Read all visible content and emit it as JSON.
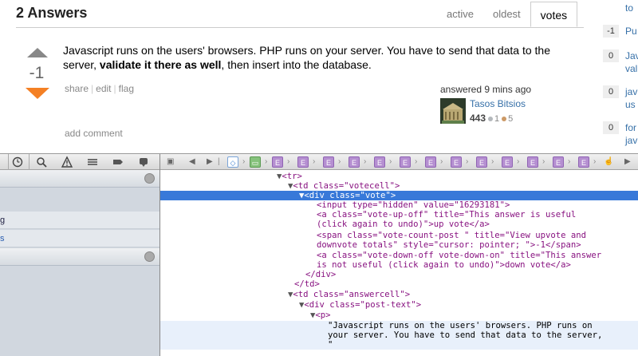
{
  "answers": {
    "title": "2 Answers",
    "tabs": [
      "active",
      "oldest",
      "votes"
    ],
    "selected_tab": "votes"
  },
  "answer": {
    "vote_count": "-1",
    "body_part1": "Javascript runs on the users' browsers. PHP runs on your server. You have to send that data to the server, ",
    "body_bold": "validate it there as well",
    "body_part2": ", then insert into the database.",
    "menu": [
      "share",
      "edit",
      "flag"
    ],
    "add_comment": "add comment",
    "action_time": "answered 9 mins ago",
    "user_name": "Tasos Bitsios",
    "reputation": "443",
    "silver_badges": "1",
    "bronze_badges": "5"
  },
  "sidebar": {
    "items": [
      {
        "score": "",
        "line1": "to",
        "line2": ""
      },
      {
        "score": "-1",
        "line1": "Pu",
        "line2": ""
      },
      {
        "score": "0",
        "line1": "Jav",
        "line2": "val"
      },
      {
        "score": "0",
        "line1": "jav",
        "line2": "us"
      },
      {
        "score": "0",
        "line1": "for",
        "line2": "jav"
      }
    ]
  },
  "left_panel": {
    "row2": "g",
    "row3": "s"
  },
  "dom": {
    "lines": [
      [
        "▼",
        "<tr>"
      ],
      [
        "▼",
        "<td class=\"votecell\">"
      ],
      [
        "▼",
        "<div class=\"vote\">"
      ],
      [
        "",
        "<input type=\"hidden\" value=\"16293181\">"
      ],
      [
        "",
        "<a class=\"vote-up-off\" title=\"This answer is useful"
      ],
      [
        "",
        "(click again to undo)\">up vote</a>"
      ],
      [
        "",
        "<span class=\"vote-count-post \" title=\"View upvote and"
      ],
      [
        "",
        "downvote totals\" style=\"cursor: pointer; \">-1</span>"
      ],
      [
        "",
        "<a class=\"vote-down-off vote-down-on\" title=\"This answer"
      ],
      [
        "",
        "is not useful (click again to undo)\">down vote</a>"
      ],
      [
        "",
        "</div>"
      ],
      [
        "",
        "</td>"
      ],
      [
        "▼",
        "<td class=\"answercell\">"
      ],
      [
        "▼",
        "<div class=\"post-text\">"
      ],
      [
        "▼",
        "<p>"
      ],
      [
        "",
        "\"Javascript runs on the users' browsers. PHP runs on"
      ],
      [
        "",
        "your server. You have to send that data to the server,"
      ],
      [
        "",
        "\""
      ]
    ]
  }
}
